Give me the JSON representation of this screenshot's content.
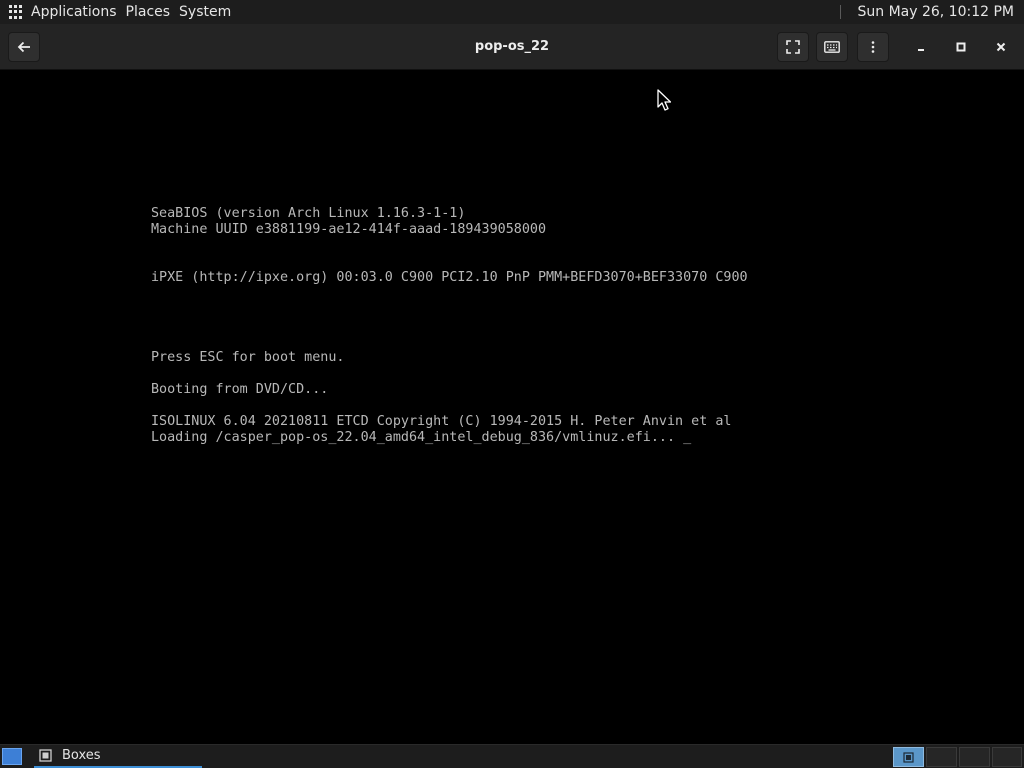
{
  "top_panel": {
    "menus": [
      "Applications",
      "Places",
      "System"
    ],
    "clock": "Sun May 26, 10:12 PM"
  },
  "window": {
    "title": "pop-os_22",
    "buttons": {
      "back": "arrow-left-icon",
      "fullscreen": "fullscreen-icon",
      "keyboard": "keyboard-icon",
      "menu": "more-vertical-icon",
      "minimize": "minimize-icon",
      "maximize": "maximize-icon",
      "close": "close-icon"
    }
  },
  "console": {
    "lines": [
      "SeaBIOS (version Arch Linux 1.16.3-1-1)",
      "Machine UUID e3881199-ae12-414f-aaad-189439058000",
      "iPXE (http://ipxe.org) 00:03.0 C900 PCI2.10 PnP PMM+BEFD3070+BEF33070 C900",
      "Press ESC for boot menu.",
      "Booting from DVD/CD...",
      "ISOLINUX 6.04 20210811 ETCD Copyright (C) 1994-2015 H. Peter Anvin et al",
      "Loading /casper_pop-os_22.04_amd64_intel_debug_836/vmlinuz.efi... _"
    ]
  },
  "taskbar": {
    "tasks": [
      {
        "label": "Boxes",
        "icon": "boxes-app-icon"
      }
    ],
    "workspaces": 4,
    "active_workspace": 1
  },
  "colors": {
    "panel_bg": "#1d1d1d",
    "header_bg": "#242424",
    "console_text": "#b8b8b8",
    "accent": "#3d8fd6"
  }
}
